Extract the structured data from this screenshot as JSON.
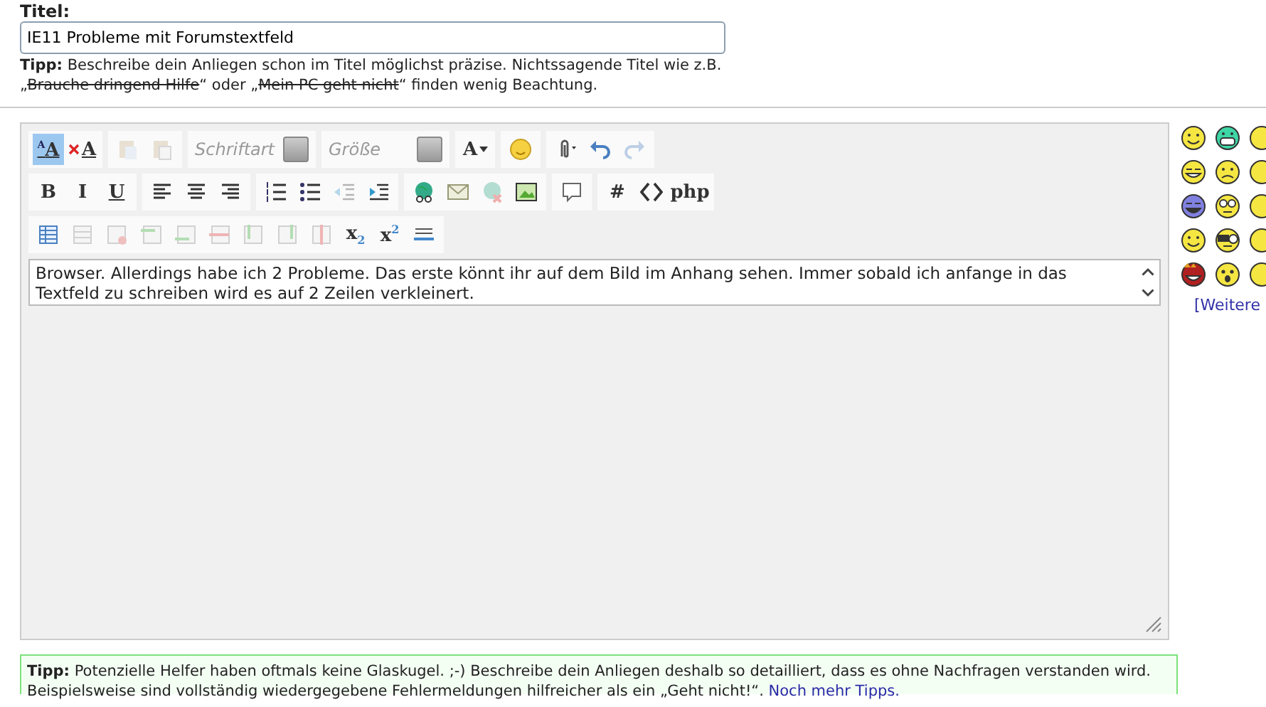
{
  "title_field": {
    "label": "Titel:",
    "value": "IE11 Probleme mit Forumstextfeld"
  },
  "title_tip": {
    "text": "**Tipp:** Beschreibe dein Anliegen schon im Titel möglichst präzise. Nichtssagende Titel wie z.B. „",
    "bad_examples": [
      "Brauche dringend Hilfe",
      "Mein PC geht nicht"
    ],
    "joiner": "“ oder „",
    "tail": "“ finden wenig Beachtung."
  },
  "toolbar_rows": [
    [
      [
        {
          "kind": "font-size-toggle",
          "glyph": "$^{A}$A",
          "selected": true,
          "disabled": false
        },
        {
          "kind": "remove-format",
          "glyph": "A",
          "selected": false,
          "disabled": false
        }
      ],
      [
        {
          "kind": "paste",
          "selected": false,
          "disabled": true
        },
        {
          "kind": "paste-word",
          "selected": false,
          "disabled": true
        }
      ],
      [
        {
          "kind": "dropdown",
          "placeholder": "Schriftart"
        }
      ],
      [
        {
          "kind": "dropdown",
          "placeholder": "Größe"
        }
      ],
      [
        {
          "kind": "text-color",
          "glyph": "A",
          "selected": false,
          "disabled": false
        }
      ],
      [
        {
          "kind": "smiley",
          "selected": false,
          "disabled": false
        }
      ],
      [
        {
          "kind": "attach",
          "selected": false,
          "disabled": false
        },
        {
          "kind": "undo",
          "selected": false,
          "disabled": false
        },
        {
          "kind": "redo",
          "selected": false,
          "disabled": true
        }
      ]
    ],
    [
      [
        {
          "kind": "bold",
          "glyph": "B",
          "selected": false,
          "disabled": false
        },
        {
          "kind": "italic",
          "glyph": "I",
          "selected": false,
          "disabled": false
        },
        {
          "kind": "underline",
          "glyph": "U",
          "selected": false,
          "disabled": false
        }
      ],
      [
        {
          "kind": "align-left",
          "selected": false,
          "disabled": false
        },
        {
          "kind": "align-center",
          "selected": false,
          "disabled": false
        },
        {
          "kind": "align-right",
          "selected": false,
          "disabled": false
        }
      ],
      [
        {
          "kind": "ordered-list",
          "selected": false,
          "disabled": false
        },
        {
          "kind": "bullet-list",
          "selected": false,
          "disabled": false
        },
        {
          "kind": "outdent",
          "selected": false,
          "disabled": true
        },
        {
          "kind": "indent",
          "selected": false,
          "disabled": false
        }
      ],
      [
        {
          "kind": "link",
          "selected": false,
          "disabled": false
        },
        {
          "kind": "email",
          "selected": false,
          "disabled": false
        },
        {
          "kind": "unlink",
          "selected": false,
          "disabled": true
        },
        {
          "kind": "image",
          "selected": false,
          "disabled": false
        }
      ],
      [
        {
          "kind": "quote",
          "selected": false,
          "disabled": false
        }
      ],
      [
        {
          "kind": "hash",
          "glyph": "#",
          "selected": false,
          "disabled": false
        },
        {
          "kind": "code",
          "selected": false,
          "disabled": false
        },
        {
          "kind": "php",
          "glyph": "php",
          "selected": false,
          "disabled": false
        }
      ]
    ],
    [
      [
        {
          "kind": "table",
          "selected": false,
          "disabled": false
        },
        {
          "kind": "table-props",
          "selected": false,
          "disabled": true
        },
        {
          "kind": "table-delete",
          "selected": false,
          "disabled": true
        },
        {
          "kind": "row-above",
          "selected": false,
          "disabled": true
        },
        {
          "kind": "row-below",
          "selected": false,
          "disabled": true
        },
        {
          "kind": "row-delete",
          "selected": false,
          "disabled": true
        },
        {
          "kind": "col-left",
          "selected": false,
          "disabled": true
        },
        {
          "kind": "col-right",
          "selected": false,
          "disabled": true
        },
        {
          "kind": "col-delete",
          "selected": false,
          "disabled": true
        },
        {
          "kind": "subscript",
          "glyph": "x$_{2}$",
          "selected": false,
          "disabled": false
        },
        {
          "kind": "superscript",
          "glyph": "x$^{2}$",
          "selected": false,
          "disabled": false
        },
        {
          "kind": "hr",
          "selected": false,
          "disabled": false
        }
      ]
    ]
  ],
  "editor": {
    "value": "Browser. Allerdings habe ich 2 Probleme. Das erste könnt ihr auf dem Bild im Anhang sehen. Immer sobald ich anfange in das Textfeld zu schreiben wird es auf 2 Zeilen verkleinert."
  },
  "smileys": [
    [
      {
        "kind": "smile",
        "color": "#f5e642"
      },
      {
        "kind": "grin",
        "color": "#3fd6a6"
      },
      {
        "kind": "partial",
        "color": "#f5e642"
      }
    ],
    [
      {
        "kind": "tongue",
        "color": "#f5e642"
      },
      {
        "kind": "sad",
        "color": "#f5e642"
      },
      {
        "kind": "partial",
        "color": "#f5e642"
      }
    ],
    [
      {
        "kind": "laugh",
        "color": "#8080e0"
      },
      {
        "kind": "glasses",
        "color": "#f5e642"
      },
      {
        "kind": "partial",
        "color": "#f5e642"
      }
    ],
    [
      {
        "kind": "smile",
        "color": "#f5e642"
      },
      {
        "kind": "eyepatch",
        "color": "#f5e642"
      },
      {
        "kind": "partial",
        "color": "#f5e642"
      }
    ],
    [
      {
        "kind": "devil",
        "color": "#b02020"
      },
      {
        "kind": "surprised",
        "color": "#f5e642"
      },
      {
        "kind": "partial",
        "color": "#f5e642"
      }
    ]
  ],
  "more_smileys_link": "[Weitere",
  "bottom_tip": {
    "text": "**Tipp:** Potenzielle Helfer haben oftmals keine Glaskugel. ;-) Beschreibe dein Anliegen deshalb so detailliert, dass es ohne Nachfragen verstanden wird. Beispielsweise sind vollständig wiedergegebene Fehlermeldungen hilfreicher als ein „Geht nicht!“.",
    "link": "Noch mehr Tipps."
  }
}
